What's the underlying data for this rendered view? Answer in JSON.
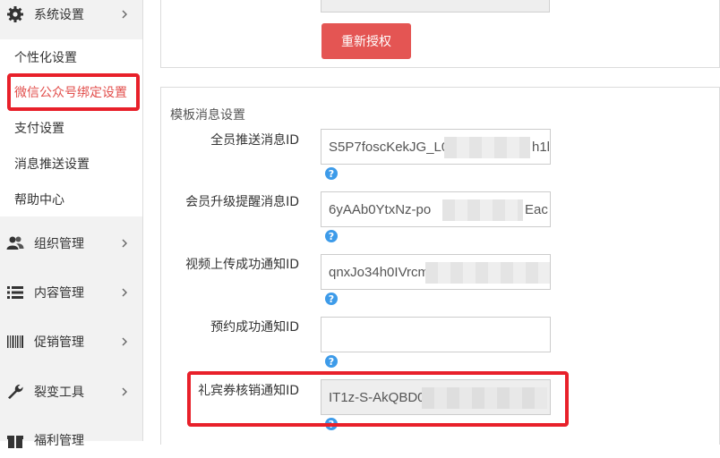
{
  "sidebar": {
    "items": [
      {
        "label": "系统设置",
        "icon": "gear-icon"
      },
      {
        "label": "组织管理",
        "icon": "users-icon"
      },
      {
        "label": "内容管理",
        "icon": "list-icon"
      },
      {
        "label": "促销管理",
        "icon": "barcode-icon"
      },
      {
        "label": "裂变工具",
        "icon": "wrench-icon"
      },
      {
        "label": "福利管理",
        "icon": "gift-icon"
      }
    ],
    "submenu": [
      {
        "label": "个性化设置"
      },
      {
        "label": "微信公众号绑定设置",
        "active": true
      },
      {
        "label": "支付设置"
      },
      {
        "label": "消息推送设置"
      },
      {
        "label": "帮助中心"
      }
    ]
  },
  "main": {
    "reauth_button": "重新授权",
    "section_title": "模板消息设置",
    "fields": [
      {
        "label": "全员推送消息ID",
        "value": "S5P7foscKekJG_L0",
        "tail": "h1l"
      },
      {
        "label": "会员升级提醒消息ID",
        "value": "6yAAb0YtxNz-po",
        "tail": "Eac"
      },
      {
        "label": "视频上传成功通知ID",
        "value": "qnxJo34h0IVrcm",
        "tail": ""
      },
      {
        "label": "预约成功通知ID",
        "value": "",
        "tail": ""
      },
      {
        "label": "礼宾券核销通知ID",
        "value": "IT1z-S-AkQBD0C",
        "tail": ""
      }
    ],
    "help_glyph": "?"
  },
  "colors": {
    "accent_red": "#e45553",
    "active_text": "#e24f4c",
    "highlight_box": "#e8202a",
    "help_blue": "#3d9be9"
  }
}
